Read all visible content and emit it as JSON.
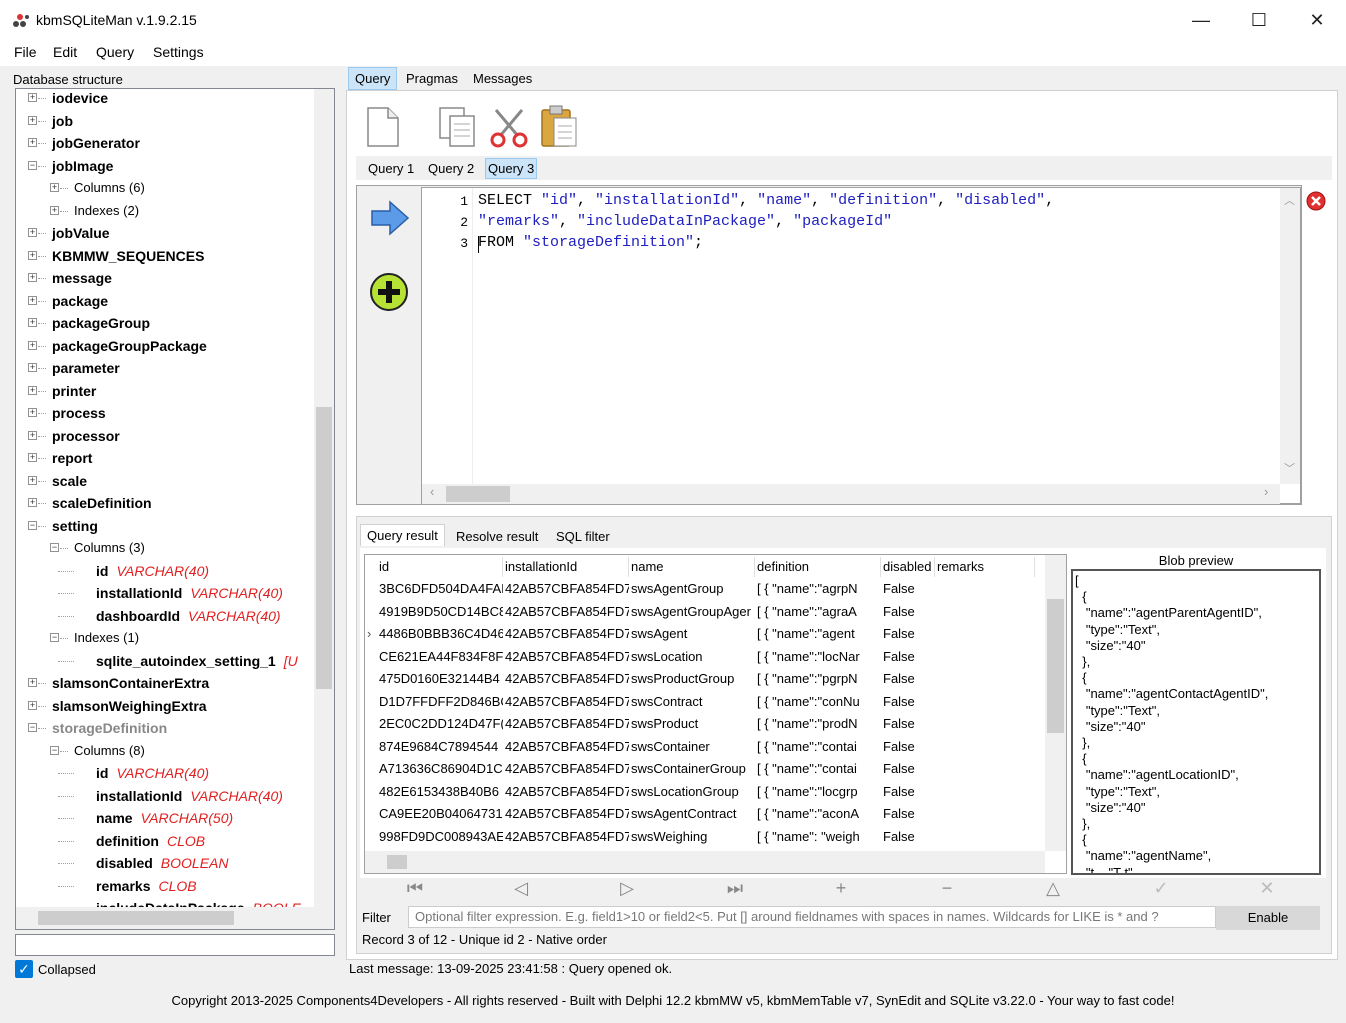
{
  "window": {
    "title": "kbmSQLiteMan v.1.9.2.15",
    "minimize": "—",
    "maximize": "☐",
    "close": "✕"
  },
  "menu": [
    "File",
    "Edit",
    "Query",
    "Settings"
  ],
  "left": {
    "label": "Database structure",
    "collapsed_label": "Collapsed",
    "collapsed_checked": true,
    "tree": [
      {
        "t": "iodevice",
        "lvl": 0,
        "b": "+",
        "bold": true
      },
      {
        "t": "job",
        "lvl": 0,
        "b": "+",
        "bold": true
      },
      {
        "t": "jobGenerator",
        "lvl": 0,
        "b": "+",
        "bold": true
      },
      {
        "t": "jobImage",
        "lvl": 0,
        "b": "−",
        "bold": true
      },
      {
        "t": "Columns (6)",
        "lvl": 1,
        "b": "+"
      },
      {
        "t": "Indexes (2)",
        "lvl": 1,
        "b": "+"
      },
      {
        "t": "jobValue",
        "lvl": 0,
        "b": "+",
        "bold": true
      },
      {
        "t": "KBMMW_SEQUENCES",
        "lvl": 0,
        "b": "+",
        "bold": true
      },
      {
        "t": "message",
        "lvl": 0,
        "b": "+",
        "bold": true
      },
      {
        "t": "package",
        "lvl": 0,
        "b": "+",
        "bold": true
      },
      {
        "t": "packageGroup",
        "lvl": 0,
        "b": "+",
        "bold": true
      },
      {
        "t": "packageGroupPackage",
        "lvl": 0,
        "b": "+",
        "bold": true
      },
      {
        "t": "parameter",
        "lvl": 0,
        "b": "+",
        "bold": true
      },
      {
        "t": "printer",
        "lvl": 0,
        "b": "+",
        "bold": true
      },
      {
        "t": "process",
        "lvl": 0,
        "b": "+",
        "bold": true
      },
      {
        "t": "processor",
        "lvl": 0,
        "b": "+",
        "bold": true
      },
      {
        "t": "report",
        "lvl": 0,
        "b": "+",
        "bold": true
      },
      {
        "t": "scale",
        "lvl": 0,
        "b": "+",
        "bold": true
      },
      {
        "t": "scaleDefinition",
        "lvl": 0,
        "b": "+",
        "bold": true
      },
      {
        "t": "setting",
        "lvl": 0,
        "b": "−",
        "bold": true
      },
      {
        "t": "Columns (3)",
        "lvl": 1,
        "b": "−"
      },
      {
        "t": "id",
        "lvl": 2,
        "bold": true,
        "typ": "VARCHAR(40)"
      },
      {
        "t": "installationId",
        "lvl": 2,
        "bold": true,
        "typ": "VARCHAR(40)"
      },
      {
        "t": "dashboardId",
        "lvl": 2,
        "bold": true,
        "typ": "VARCHAR(40)"
      },
      {
        "t": "Indexes (1)",
        "lvl": 1,
        "b": "−"
      },
      {
        "t": "sqlite_autoindex_setting_1",
        "lvl": 2,
        "bold": true,
        "typ": "[U"
      },
      {
        "t": "slamsonContainerExtra",
        "lvl": 0,
        "b": "+",
        "bold": true
      },
      {
        "t": "slamsonWeighingExtra",
        "lvl": 0,
        "b": "+",
        "bold": true
      },
      {
        "t": "storageDefinition",
        "lvl": 0,
        "b": "−",
        "bold": true,
        "grey": true
      },
      {
        "t": "Columns (8)",
        "lvl": 1,
        "b": "−"
      },
      {
        "t": "id",
        "lvl": 2,
        "bold": true,
        "typ": "VARCHAR(40)"
      },
      {
        "t": "installationId",
        "lvl": 2,
        "bold": true,
        "typ": "VARCHAR(40)"
      },
      {
        "t": "name",
        "lvl": 2,
        "bold": true,
        "typ": "VARCHAR(50)"
      },
      {
        "t": "definition",
        "lvl": 2,
        "bold": true,
        "typ": "CLOB"
      },
      {
        "t": "disabled",
        "lvl": 2,
        "bold": true,
        "typ": "BOOLEAN"
      },
      {
        "t": "remarks",
        "lvl": 2,
        "bold": true,
        "typ": "CLOB"
      },
      {
        "t": "includeDataInPackage",
        "lvl": 2,
        "bold": true,
        "typ": "BOOLE"
      }
    ]
  },
  "tabs_main": [
    "Query",
    "Pragmas",
    "Messages"
  ],
  "query_tabs": [
    "Query 1",
    "Query 2",
    "Query 3"
  ],
  "sql": {
    "line1_nums": [
      "1",
      "2",
      "3"
    ],
    "line1": [
      [
        "kw",
        "SELECT "
      ],
      [
        "str",
        "\"id\""
      ],
      [
        "kw",
        ", "
      ],
      [
        "str",
        "\"installationId\""
      ],
      [
        "kw",
        ", "
      ],
      [
        "str",
        "\"name\""
      ],
      [
        "kw",
        ", "
      ],
      [
        "str",
        "\"definition\""
      ],
      [
        "kw",
        ", "
      ],
      [
        "str",
        "\"disabled\""
      ],
      [
        "kw",
        ","
      ]
    ],
    "line2": [
      [
        "str",
        "\"remarks\""
      ],
      [
        "kw",
        ", "
      ],
      [
        "str",
        "\"includeDataInPackage\""
      ],
      [
        "kw",
        ", "
      ],
      [
        "str",
        "\"packageId\""
      ]
    ],
    "line3": [
      [
        "kw",
        "FROM "
      ],
      [
        "str",
        "\"storageDefinition\""
      ],
      [
        "kw",
        ";"
      ]
    ]
  },
  "result_tabs": [
    "Query result",
    "Resolve result",
    "SQL filter"
  ],
  "grid": {
    "headers": [
      "id",
      "installationId",
      "name",
      "definition",
      "disabled",
      "remarks"
    ],
    "rows": [
      [
        "3BC6DFD504DA4FAI",
        "42AB57CBFA854FD7",
        "swsAgentGroup",
        "[ {   \"name\":\"agrpN",
        "False"
      ],
      [
        "4919B9D50CD14BC8",
        "42AB57CBFA854FD7",
        "swsAgentGroupAger",
        "[ {   \"name\":\"agraA",
        "False"
      ],
      [
        "4486B0BBB36C4D46",
        "42AB57CBFA854FD7",
        "swsAgent",
        "[ {   \"name\":\"agent",
        "False"
      ],
      [
        "CE621EA44F834F8F",
        "42AB57CBFA854FD7",
        "swsLocation",
        "[ {   \"name\":\"locNar",
        "False"
      ],
      [
        "475D0160E32144B4",
        "42AB57CBFA854FD7",
        "swsProductGroup",
        "[ {   \"name\":\"pgrpN",
        "False"
      ],
      [
        "D1D7FFDFF2D846BC",
        "42AB57CBFA854FD7",
        "swsContract",
        "[ {   \"name\":\"conNu",
        "False"
      ],
      [
        "2EC0C2DD124D47F(",
        "42AB57CBFA854FD7",
        "swsProduct",
        "[ {   \"name\":\"prodN",
        "False"
      ],
      [
        "874E9684C7894544",
        "42AB57CBFA854FD7",
        "swsContainer",
        "[ {   \"name\":\"contai",
        "False"
      ],
      [
        "A713636C86904D1C",
        "42AB57CBFA854FD7",
        "swsContainerGroup",
        "[ {   \"name\":\"contai",
        "False"
      ],
      [
        "482E6153438B40B6",
        "42AB57CBFA854FD7",
        "swsLocationGroup",
        "[ {   \"name\":\"locgrp",
        "False"
      ],
      [
        "CA9EE20B04064731",
        "42AB57CBFA854FD7",
        "swsAgentContract",
        "[ {   \"name\":\"aconA",
        "False"
      ],
      [
        "998FD9DC008943AE",
        "42AB57CBFA854FD7",
        "swsWeighing",
        "[ {   \"name\": \"weigh",
        "False"
      ]
    ]
  },
  "blob": {
    "label": "Blob preview",
    "lines": [
      "[",
      "  {",
      "   \"name\":\"agentParentAgentID\",",
      "   \"type\":\"Text\",",
      "   \"size\":\"40\"",
      "  },",
      "  {",
      "   \"name\":\"agentContactAgentID\",",
      "   \"type\":\"Text\",",
      "   \"size\":\"40\"",
      "  },",
      "  {",
      "   \"name\":\"agentLocationID\",",
      "   \"type\":\"Text\",",
      "   \"size\":\"40\"",
      "  },",
      "  {",
      "   \"name\":\"agentName\",",
      "   \"t    \"T t\""
    ]
  },
  "nav": [
    "⏮",
    "◁",
    "▷",
    "⏭",
    "+",
    "−",
    "△",
    "✓",
    "✕"
  ],
  "filter": {
    "label": "Filter",
    "placeholder": "Optional filter expression. E.g. field1>10 or field2<5. Put [] around fieldnames with spaces in names. Wildcards for LIKE is * and ?",
    "enable": "Enable"
  },
  "record_status": "Record 3 of 12 - Unique id 2 - Native order",
  "last_message": "Last message: 13-09-2025 23:41:58 : Query opened ok.",
  "copyright": "Copyright 2013-2025 Components4Developers - All rights reserved - Built with Delphi 12.2 kbmMW v5, kbmMemTable v7, SynEdit and SQLite v3.22.0 - Your way to fast code!"
}
